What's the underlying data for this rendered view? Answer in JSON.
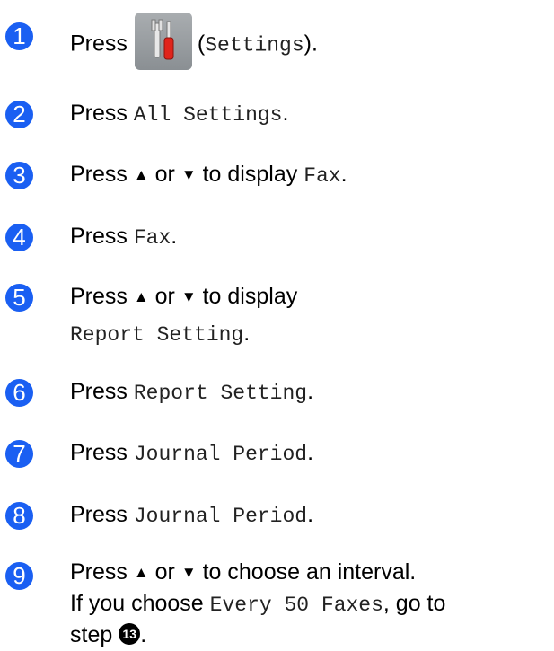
{
  "badge_color": "#1a5ff2",
  "steps": [
    {
      "num": "1",
      "press": "Press",
      "paren_open": "(",
      "settings": "Settings",
      "paren_close": ").",
      "icon": "settings-tools-icon"
    },
    {
      "num": "2",
      "press": "Press",
      "code": "All Settings",
      "end": "."
    },
    {
      "num": "3",
      "press": "Press",
      "up": "▲",
      "or": "or",
      "down": "▼",
      "display": "to display",
      "code": "Fax",
      "end": "."
    },
    {
      "num": "4",
      "press": "Press",
      "code": "Fax",
      "end": "."
    },
    {
      "num": "5",
      "press": "Press",
      "up": "▲",
      "or": "or",
      "down": "▼",
      "display": "to display",
      "code": "Report Setting",
      "end": "."
    },
    {
      "num": "6",
      "press": "Press",
      "code": "Report Setting",
      "end": "."
    },
    {
      "num": "7",
      "press": "Press",
      "code": "Journal Period",
      "end": "."
    },
    {
      "num": "8",
      "press": "Press",
      "code": "Journal Period",
      "end": "."
    },
    {
      "num": "9",
      "press": "Press",
      "up": "▲",
      "or": "or",
      "down": "▼",
      "choose": "to choose an interval.",
      "if_choose": "If you choose",
      "code": "Every 50 Faxes",
      "goto": ", go to",
      "step": "step",
      "ref": "13",
      "end": "."
    }
  ]
}
